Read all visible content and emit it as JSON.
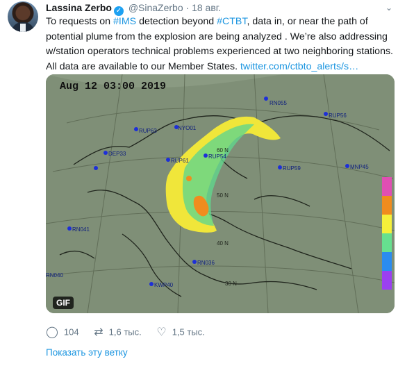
{
  "author": {
    "name": "Lassina Zerbo",
    "handle": "@SinaZerbo",
    "separator": "·",
    "date": "18 авг."
  },
  "tweet": {
    "t1": "To requests on ",
    "tag_ims": "#IMS",
    "t2": " detection beyond ",
    "tag_ctbt": "#CTBT",
    "t3": ", data in, or near the path of potential plume from the explosion are being analyzed . We’re also addressing w/station operators technical problems experienced at two neighboring stations. All data are available to our Member States. ",
    "link": "twitter.com/ctbto_alerts/s…"
  },
  "media": {
    "timestamp": "Aug 12 03:00 2019",
    "badge": "GIF",
    "stations": [
      "RN055",
      "RUP56",
      "RUP63",
      "NYO01",
      "RUP61",
      "RUP54",
      "RUP59",
      "MNP45",
      "DEP33",
      "RN041",
      "RN036",
      "KWP40",
      "RN040"
    ],
    "latitude_labels": [
      "50 N",
      "40 N",
      "60 N",
      "30 N"
    ],
    "legend_colors": [
      "#e04fb3",
      "#f08c1e",
      "#f5f03a",
      "#66e08f",
      "#2b8cf0",
      "#9b40f0"
    ],
    "legend_ticks": [
      "10",
      "10",
      "10",
      "10",
      "10"
    ],
    "map_colors": {
      "background": "#7a8a73",
      "plume_outer": "#f0e63a",
      "plume_inner": "#62d68c",
      "plume_core": "#f08c1e"
    }
  },
  "actions": {
    "replies": "104",
    "retweets": "1,6 тыс.",
    "likes": "1,5 тыс."
  },
  "thread_link": "Показать эту ветку",
  "icons": [
    "verified-badge-icon",
    "chevron-down-icon",
    "reply-icon",
    "retweet-icon",
    "like-icon"
  ]
}
